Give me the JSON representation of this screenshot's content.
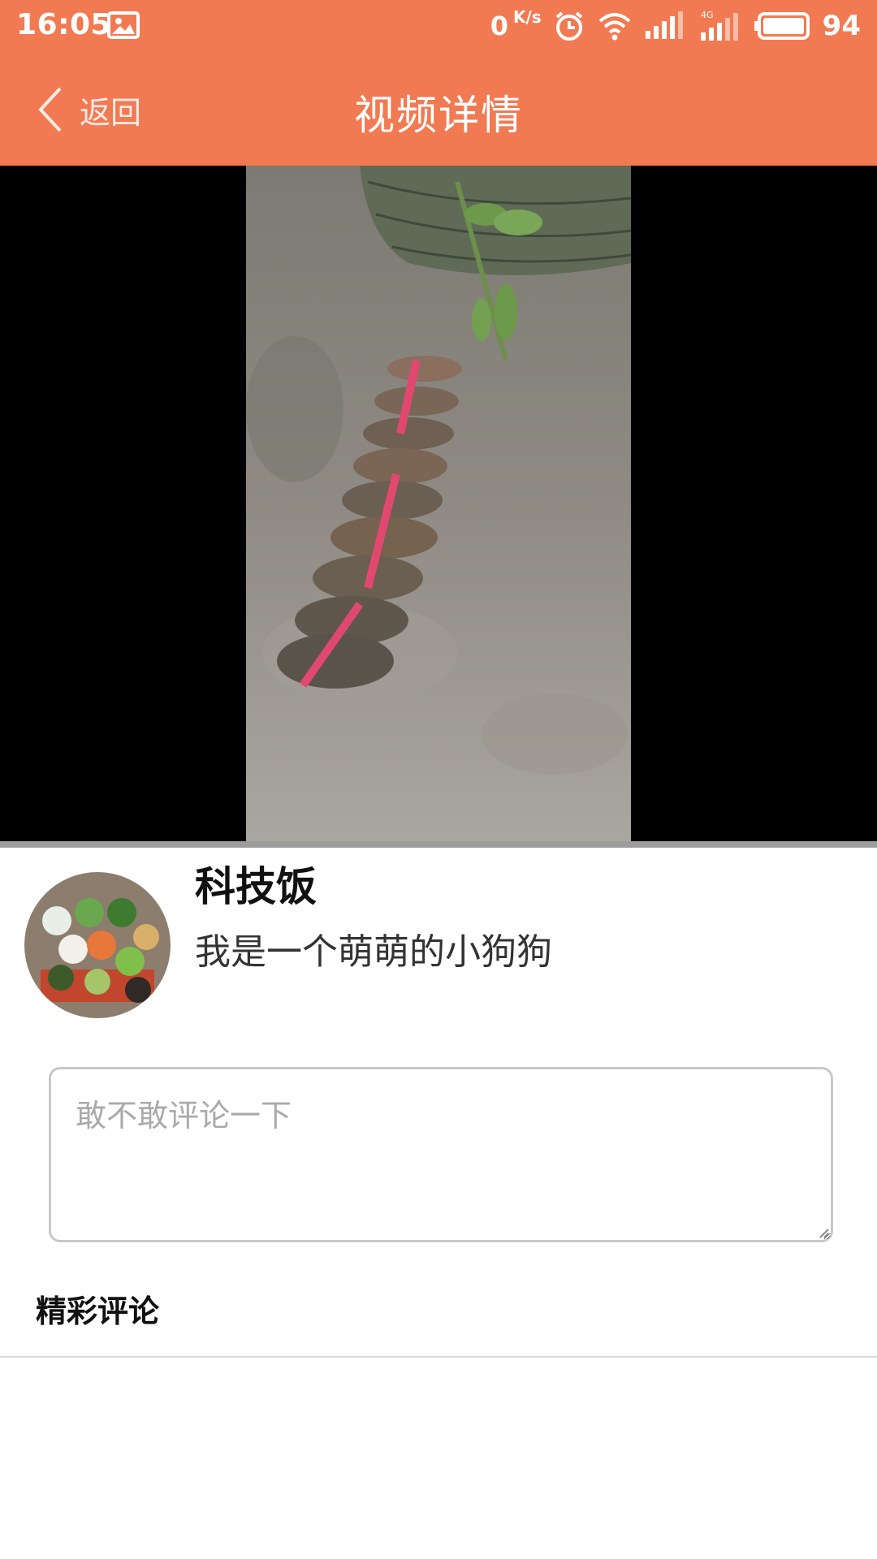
{
  "status_bar": {
    "time": "16:05",
    "net_speed_value": "0",
    "net_speed_unit": "K/s",
    "battery": "94",
    "icons": [
      "gallery-icon",
      "alarm-icon",
      "wifi-icon",
      "signal-icon",
      "signal-4g-icon",
      "battery-icon"
    ]
  },
  "nav": {
    "back_label": "返回",
    "title": "视频详情",
    "background": "#f27a52"
  },
  "video": {
    "playing_state": "paused"
  },
  "author": {
    "name": "科技饭",
    "bio": "我是一个萌萌的小狗狗"
  },
  "comment": {
    "placeholder": "敢不敢评论一下",
    "value": ""
  },
  "comments_section": {
    "title": "精彩评论"
  }
}
